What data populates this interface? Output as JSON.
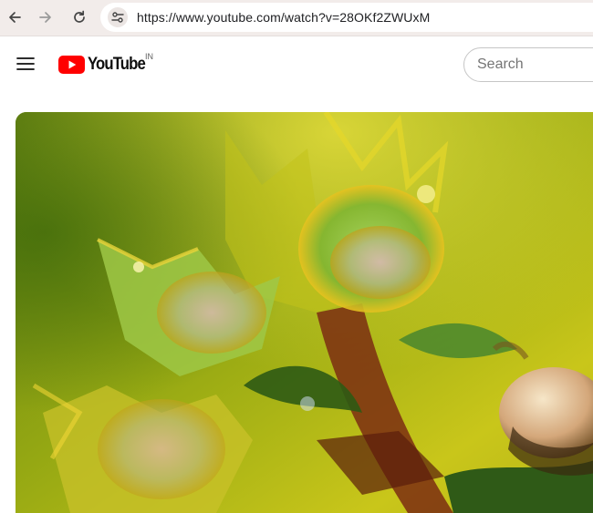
{
  "browser": {
    "url": "https://www.youtube.com/watch?v=28OKf2ZWUxM",
    "icons": [
      "back-arrow-icon",
      "forward-arrow-icon",
      "reload-icon",
      "site-settings-icon"
    ]
  },
  "header": {
    "logo_text": "YouTube",
    "country_code": "IN",
    "search_placeholder": "Search",
    "icons": [
      "hamburger-menu-icon",
      "youtube-play-icon"
    ]
  },
  "colors": {
    "browser_bar": "#f2ecea",
    "youtube_red": "#ff0000",
    "text": "#0f0f0f"
  }
}
